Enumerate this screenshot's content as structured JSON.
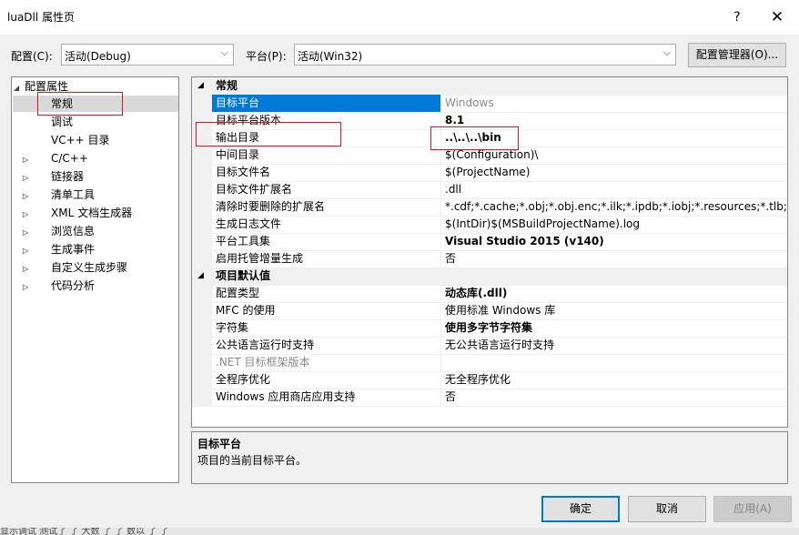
{
  "window": {
    "title": "luaDll 属性页",
    "help_label": "?",
    "close_label": "✕"
  },
  "toolbar": {
    "config_label": "配置(C):",
    "config_value": "活动(Debug)",
    "platform_label": "平台(P):",
    "platform_value": "活动(Win32)",
    "config_manager_label": "配置管理器(O)..."
  },
  "tree": {
    "root_label": "配置属性",
    "items": [
      {
        "label": "常规",
        "expander": "",
        "selected": true
      },
      {
        "label": "调试",
        "expander": ""
      },
      {
        "label": "VC++ 目录",
        "expander": ""
      },
      {
        "label": "C/C++",
        "expander": "▷"
      },
      {
        "label": "链接器",
        "expander": "▷"
      },
      {
        "label": "清单工具",
        "expander": "▷"
      },
      {
        "label": "XML 文档生成器",
        "expander": "▷"
      },
      {
        "label": "浏览信息",
        "expander": "▷"
      },
      {
        "label": "生成事件",
        "expander": "▷"
      },
      {
        "label": "自定义生成步骤",
        "expander": "▷"
      },
      {
        "label": "代码分析",
        "expander": "▷"
      }
    ]
  },
  "grid": {
    "categories": [
      {
        "name": "常规",
        "rows": [
          {
            "name": "目标平台",
            "value": "Windows",
            "selected": true,
            "value_style": "dim"
          },
          {
            "name": "目标平台版本",
            "value": "8.1",
            "value_style": "bold"
          },
          {
            "name": "输出目录",
            "value": "..\\..\\..\\bin",
            "value_style": "bold"
          },
          {
            "name": "中间目录",
            "value": "$(Configuration)\\"
          },
          {
            "name": "目标文件名",
            "value": "$(ProjectName)"
          },
          {
            "name": "目标文件扩展名",
            "value": ".dll"
          },
          {
            "name": "清除时要删除的扩展名",
            "value": "*.cdf;*.cache;*.obj;*.obj.enc;*.ilk;*.ipdb;*.iobj;*.resources;*.tlb;*.tli;*.t"
          },
          {
            "name": "生成日志文件",
            "value": "$(IntDir)$(MSBuildProjectName).log"
          },
          {
            "name": "平台工具集",
            "value": "Visual Studio 2015 (v140)",
            "value_style": "bold"
          },
          {
            "name": "启用托管增量生成",
            "value": "否"
          }
        ]
      },
      {
        "name": "项目默认值",
        "rows": [
          {
            "name": "配置类型",
            "value": "动态库(.dll)",
            "value_style": "bold"
          },
          {
            "name": "MFC 的使用",
            "value": "使用标准 Windows 库"
          },
          {
            "name": "字符集",
            "value": "使用多字节字符集",
            "value_style": "bold"
          },
          {
            "name": "公共语言运行时支持",
            "value": "无公共语言运行时支持"
          },
          {
            "name": ".NET 目标框架版本",
            "value": "",
            "name_style": "dim"
          },
          {
            "name": "全程序优化",
            "value": "无全程序优化"
          },
          {
            "name": "Windows 应用商店应用支持",
            "value": "否"
          }
        ]
      }
    ]
  },
  "description": {
    "title": "目标平台",
    "text": "项目的当前目标平台。"
  },
  "buttons": {
    "ok": "确定",
    "cancel": "取消",
    "apply": "应用(A)"
  },
  "taskbar": {
    "text": "显示调试 测试了 了 大数 了 了 数以 了 了"
  },
  "colors": {
    "selection": "#0078d7",
    "annotation": "#e81123"
  }
}
